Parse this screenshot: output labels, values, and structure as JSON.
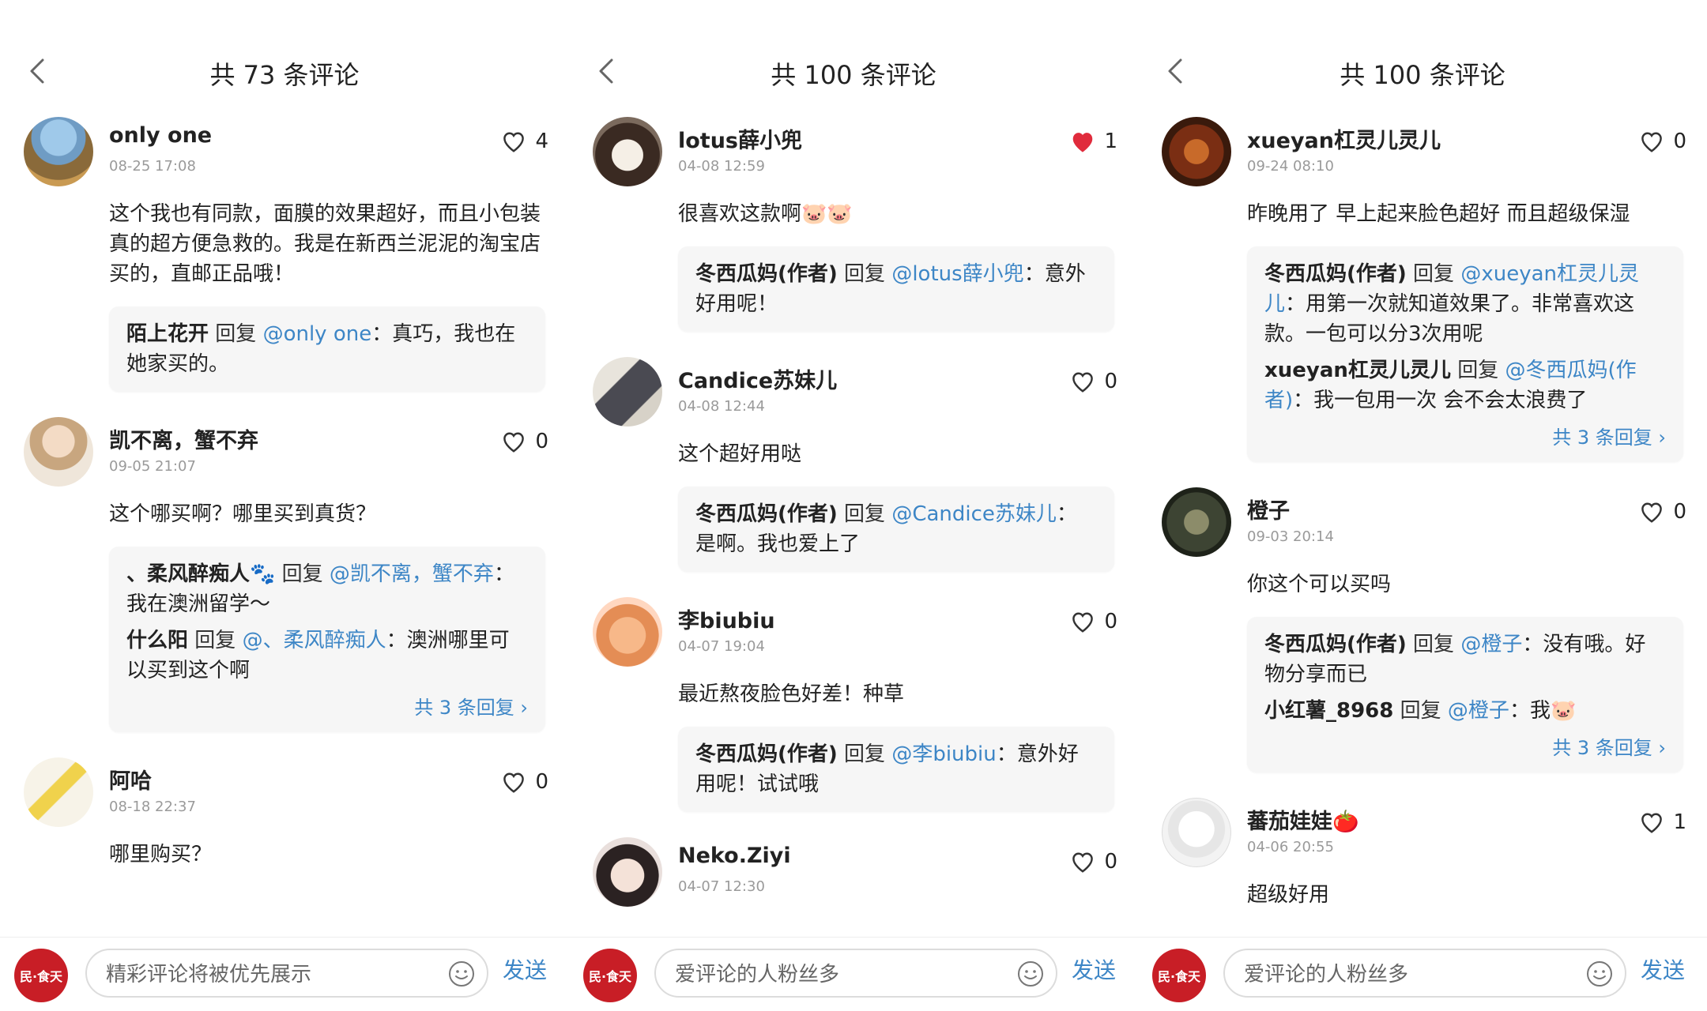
{
  "colors": {
    "accent": "#3d86c6",
    "liked": "#e02b3c",
    "brand": "#c81e26",
    "reply_bg": "#f6f6f6"
  },
  "icons": {
    "back": "chevron-left-icon",
    "like": "heart-outline-icon",
    "liked": "heart-filled-icon",
    "emoji": "smiley-icon"
  },
  "panels": [
    {
      "title": "共 73 条评论",
      "comments": [
        {
          "name": "only one",
          "time": "08-25 17:08",
          "likes": "4",
          "liked": false,
          "text": "这个我也有同款，面膜的效果超好，而且小包装真的超方便急救的。我是在新西兰泥泥的淘宝店买的，直邮正品哦！",
          "replies": [
            {
              "name": "陌上花开",
              "verb": "回复",
              "at": "@only one",
              "text": "：真巧，我也在她家买的。"
            }
          ]
        },
        {
          "name": "凯不离，蟹不弃",
          "time": "09-05 21:07",
          "likes": "0",
          "liked": false,
          "text": "这个哪买啊？哪里买到真货？",
          "replies": [
            {
              "name": "、柔风醉痴人🐾",
              "verb": "回复",
              "at": "@凯不离，蟹不弃",
              "text": "：我在澳洲留学～"
            },
            {
              "name": "什么阳",
              "verb": "回复",
              "at": "@、柔风醉痴人",
              "text": "：澳洲哪里可以买到这个啊"
            }
          ],
          "more": "共 3 条回复 ›"
        },
        {
          "name": "阿哈",
          "time": "08-18 22:37",
          "likes": "0",
          "liked": false,
          "text": "哪里购买？",
          "replies": []
        }
      ],
      "input_placeholder": "精彩评论将被优先展示",
      "send": "发送",
      "brand": "民·食天"
    },
    {
      "title": "共 100 条评论",
      "comments": [
        {
          "name": "lotus薛小兜",
          "time": "04-08 12:59",
          "likes": "1",
          "liked": true,
          "text": "很喜欢这款啊🐷🐷",
          "replies": [
            {
              "name": "冬西瓜妈(作者)",
              "verb": "回复",
              "at": "@lotus薛小兜",
              "text": "：意外好用呢！"
            }
          ]
        },
        {
          "name": "Candice苏妹儿",
          "time": "04-08 12:44",
          "likes": "0",
          "liked": false,
          "text": "这个超好用哒",
          "replies": [
            {
              "name": "冬西瓜妈(作者)",
              "verb": "回复",
              "at": "@Candice苏妹儿",
              "text": "：是啊。我也爱上了"
            }
          ]
        },
        {
          "name": "李biubiu",
          "time": "04-07 19:04",
          "likes": "0",
          "liked": false,
          "text": "最近熬夜脸色好差！种草",
          "replies": [
            {
              "name": "冬西瓜妈(作者)",
              "verb": "回复",
              "at": "@李biubiu",
              "text": "：意外好用呢！试试哦"
            }
          ]
        },
        {
          "name": "Neko.Ziyi",
          "time": "04-07 12:30",
          "likes": "0",
          "liked": false,
          "text": "",
          "replies": []
        }
      ],
      "input_placeholder": "爱评论的人粉丝多",
      "send": "发送",
      "brand": "民·食天"
    },
    {
      "title": "共 100 条评论",
      "comments": [
        {
          "name": "xueyan杠灵儿灵儿",
          "time": "09-24 08:10",
          "likes": "0",
          "liked": false,
          "text": "昨晚用了 早上起来脸色超好 而且超级保湿",
          "replies": [
            {
              "name": "冬西瓜妈(作者)",
              "verb": "回复",
              "at": "@xueyan杠灵儿灵儿",
              "text": "：用第一次就知道效果了。非常喜欢这款。一包可以分3次用呢"
            },
            {
              "name": "xueyan杠灵儿灵儿",
              "verb": "回复",
              "at": "@冬西瓜妈(作者)",
              "text": "：我一包用一次 会不会太浪费了"
            }
          ],
          "more": "共 3 条回复 ›"
        },
        {
          "name": "橙子",
          "time": "09-03 20:14",
          "likes": "0",
          "liked": false,
          "text": "你这个可以买吗",
          "replies": [
            {
              "name": "冬西瓜妈(作者)",
              "verb": "回复",
              "at": "@橙子",
              "text": "：没有哦。好物分享而已"
            },
            {
              "name": "小红薯_8968",
              "verb": "回复",
              "at": "@橙子",
              "text": "：我🐷"
            }
          ],
          "more": "共 3 条回复 ›"
        },
        {
          "name": "蕃茄娃娃🍅",
          "time": "04-06 20:55",
          "likes": "1",
          "liked": false,
          "text": "超级好用",
          "replies": []
        }
      ],
      "input_placeholder": "爱评论的人粉丝多",
      "send": "发送",
      "brand": "民·食天"
    }
  ]
}
